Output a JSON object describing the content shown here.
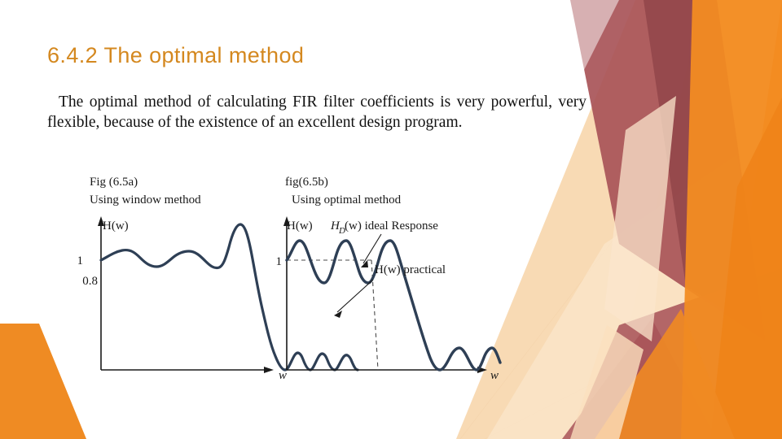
{
  "slide": {
    "title": "6.4.2 The optimal method",
    "body": "The optimal method of calculating FIR filter coefficients is very powerful, very flexible, because of the existence of an excellent design program."
  },
  "theme": {
    "title_color": "#D4881F",
    "accent_orange": "#EF8B23",
    "accent_orange_light": "#F6A04A",
    "accent_peach": "#F8DCBA",
    "accent_maroon": "#A85458",
    "accent_maroon_dark": "#8E3F44",
    "curve_color": "#2E3F55",
    "axis_color": "#1a1a1a",
    "body_color": "#111111",
    "background": "#FFFFFF"
  },
  "figure": {
    "left_plot": {
      "caption_line1": "Fig (6.5a)",
      "caption_line2": "Using window method",
      "y_axis_label": "H(w)",
      "x_axis_label": "w",
      "y_ticks": [
        "1",
        "0.8"
      ]
    },
    "right_plot": {
      "caption_line1": "fig(6.5b)",
      "caption_line2": "Using optimal method",
      "y_axis_label": "H(w)",
      "ideal_label_main": "H",
      "ideal_label_sub": "D",
      "ideal_label_rest": "(w)  ideal Response",
      "practical_label": "H(w)  practical",
      "x_axis_label": "w",
      "y_ticks": [
        "1"
      ]
    }
  },
  "chart_data": [
    {
      "type": "line",
      "title": "Fig (6.5a) Using window method",
      "xlabel": "w",
      "ylabel": "H(w)",
      "ylim": [
        0,
        1.35
      ],
      "xlim": [
        0,
        1
      ],
      "grid": false,
      "legend": null,
      "ytick_values": [
        1,
        0.8
      ],
      "ytick_labels": [
        "1",
        "0.8"
      ],
      "description": "Window-method FIR lowpass magnitude response: non-uniform passband ripple about 1, large Gibbs overshoot near the band edge, steep transition, decaying stopband ripples.",
      "series": [
        {
          "name": "H(w) window method",
          "x": [
            0.0,
            0.03,
            0.07,
            0.11,
            0.15,
            0.19,
            0.23,
            0.27,
            0.31,
            0.35,
            0.39,
            0.43,
            0.47,
            0.51,
            0.55,
            0.58,
            0.61,
            0.64,
            0.67,
            0.7,
            0.73,
            0.76,
            0.79,
            0.82,
            0.85,
            0.88,
            0.91,
            0.94,
            0.97,
            1.0
          ],
          "y": [
            1.0,
            1.02,
            1.06,
            1.07,
            1.04,
            1.0,
            0.97,
            0.96,
            0.99,
            1.03,
            1.06,
            1.05,
            1.01,
            0.97,
            0.95,
            1.02,
            1.18,
            1.29,
            1.22,
            1.0,
            0.72,
            0.45,
            0.22,
            0.06,
            0.0,
            0.12,
            0.02,
            0.13,
            0.02,
            0.1
          ]
        }
      ]
    },
    {
      "type": "line",
      "title": "fig(6.5b) Using optimal method",
      "xlabel": "w",
      "ylabel": "H(w)",
      "ylim": [
        0,
        1.35
      ],
      "xlim": [
        0,
        1
      ],
      "grid": false,
      "legend": [
        "H_D(w) ideal Response",
        "H(w) practical"
      ],
      "ytick_values": [
        1
      ],
      "ytick_labels": [
        "1"
      ],
      "cutoff_x": 0.52,
      "description": "Optimal (equiripple / Parks-McClellan) FIR lowpass magnitude response: uniform equal-amplitude ripples about 1 in the passband, linear transition, equal-amplitude stopband ripples. Dashed lines show the ideal brick-wall response.",
      "series": [
        {
          "name": "H(w) practical",
          "x": [
            0.0,
            0.04,
            0.08,
            0.12,
            0.16,
            0.2,
            0.24,
            0.28,
            0.32,
            0.36,
            0.4,
            0.44,
            0.48,
            0.52,
            0.56,
            0.6,
            0.64,
            0.68,
            0.72,
            0.76,
            0.8,
            0.84,
            0.88,
            0.92,
            0.96,
            1.0
          ],
          "y": [
            1.0,
            1.14,
            1.14,
            0.88,
            0.88,
            1.14,
            1.14,
            0.88,
            0.88,
            1.14,
            1.14,
            0.96,
            0.7,
            0.48,
            0.3,
            0.14,
            0.02,
            0.02,
            0.16,
            0.16,
            0.02,
            0.02,
            0.16,
            0.16,
            0.02,
            0.16
          ]
        },
        {
          "name": "H_D(w) ideal Response",
          "style": "dashed",
          "x": [
            0.0,
            0.52,
            0.52,
            1.0
          ],
          "y": [
            1.0,
            1.0,
            0.0,
            0.0
          ]
        }
      ]
    }
  ]
}
